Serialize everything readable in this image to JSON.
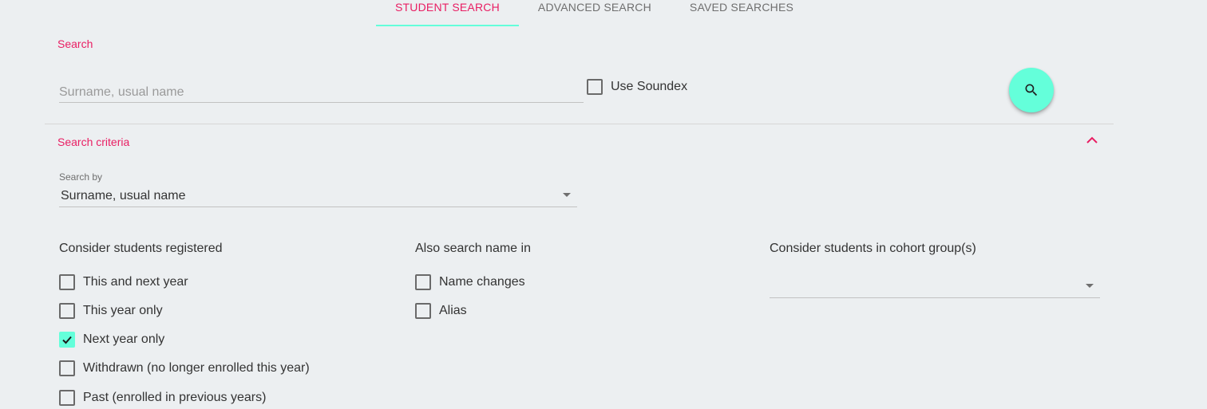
{
  "tabs": [
    {
      "label": "STUDENT SEARCH",
      "active": true
    },
    {
      "label": "ADVANCED SEARCH",
      "active": false
    },
    {
      "label": "SAVED SEARCHES",
      "active": false
    }
  ],
  "search": {
    "section_label": "Search",
    "placeholder": "Surname, usual name",
    "value": "",
    "soundex_label": "Use Soundex",
    "soundex_checked": false,
    "button_icon": "search-icon"
  },
  "criteria": {
    "section_label": "Search criteria",
    "collapse_icon": "chevron-up-icon",
    "search_by": {
      "label": "Search by",
      "value": "Surname, usual name"
    },
    "registered": {
      "title": "Consider students registered",
      "options": [
        {
          "label": "This and next year",
          "checked": false
        },
        {
          "label": "This year only",
          "checked": false
        },
        {
          "label": "Next year only",
          "checked": true
        },
        {
          "label": "Withdrawn (no longer enrolled this year)",
          "checked": false
        },
        {
          "label": "Past (enrolled in previous years)",
          "checked": false
        }
      ]
    },
    "also_search": {
      "title": "Also search name in",
      "options": [
        {
          "label": "Name changes",
          "checked": false
        },
        {
          "label": "Alias",
          "checked": false
        }
      ]
    },
    "cohort": {
      "title": "Consider students in cohort group(s)",
      "value": ""
    }
  },
  "colors": {
    "accent": "#e91e63",
    "teal": "#64ffda",
    "background": "#eceff1"
  }
}
